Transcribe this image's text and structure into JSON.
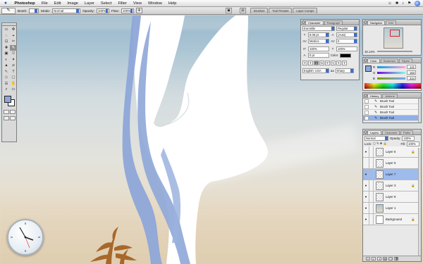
{
  "menubar": {
    "apple": "",
    "items": [
      "Photoshop",
      "File",
      "Edit",
      "Image",
      "Layer",
      "Select",
      "Filter",
      "View",
      "Window",
      "Help"
    ],
    "status_icons": [
      "☺",
      "✱",
      "♪",
      "⚑"
    ]
  },
  "options": {
    "brush_label": "Brush:",
    "brush_size": "",
    "mode_label": "Mode:",
    "mode_value": "Normal",
    "opacity_label": "Opacity:",
    "opacity_value": "100%",
    "flow_label": "Flow:",
    "flow_value": "100%",
    "well_tabs": [
      "Brushes",
      "Tool Presets",
      "Layer Comps"
    ]
  },
  "tools": {
    "foreground_color": "#8ea7d8",
    "background_color": "#ffffff",
    "glyphs": [
      "▭",
      "✥",
      "◌",
      "⌖",
      "⊡",
      "✂",
      "✚",
      "✎",
      "▣",
      "⎋",
      "◐",
      "✦",
      "▲",
      "⌀",
      "↖",
      "T",
      "◇",
      "▢",
      "☰",
      "✋",
      "⌕",
      "▭"
    ]
  },
  "character": {
    "tabs": [
      "Character",
      "Paragraph"
    ],
    "font_family": "Eurostile",
    "font_style": "Regular",
    "font_size": "9.08 pt",
    "leading": "(Auto)",
    "kerning": "Metrics",
    "tracking": "0",
    "vertical_scale": "100%",
    "horizontal_scale": "100%",
    "baseline_shift": "0 pt",
    "color_label": "Color:",
    "style_buttons": [
      "T",
      "T",
      "TT",
      "Tr",
      "T'",
      "T,",
      "T",
      "T"
    ],
    "language": "English: USA",
    "antialias_label": "aa",
    "antialias": "Sharp"
  },
  "navigator": {
    "tabs": [
      "Navigator",
      "Info"
    ],
    "zoom": "16.14%"
  },
  "color": {
    "tabs": [
      "Color",
      "Swatches",
      "Styles"
    ],
    "r_label": "R",
    "g_label": "G",
    "b_label": "B",
    "r": "121",
    "g": "163",
    "b": "224"
  },
  "history": {
    "tabs": [
      "History",
      "Actions"
    ],
    "items": [
      "Brush Tool",
      "Brush Tool",
      "Brush Tool",
      "Brush Tool"
    ]
  },
  "layers": {
    "tabs": [
      "Layers",
      "Channels",
      "Paths"
    ],
    "blend_mode": "Normal",
    "opacity_label": "Opacity:",
    "opacity": "100%",
    "lock_label": "Lock:",
    "fill_label": "Fill:",
    "fill": "100%",
    "rows": [
      {
        "name": "Layer 6",
        "visible": "●",
        "thumb": "transparent",
        "lock": "🔒"
      },
      {
        "name": "Layer 5",
        "visible": "",
        "thumb": "transparent",
        "lock": ""
      },
      {
        "name": "Layer 7",
        "visible": "●",
        "thumb": "transparent",
        "lock": ""
      },
      {
        "name": "Layer 3",
        "visible": "●",
        "thumb": "transparent",
        "lock": "🔒"
      },
      {
        "name": "Layer 8",
        "visible": "●",
        "thumb": "transparent",
        "lock": ""
      },
      {
        "name": "Layer 1",
        "visible": "●",
        "thumb": "photo",
        "lock": ""
      },
      {
        "name": "Background",
        "visible": "●",
        "thumb": "white",
        "lock": "🔒"
      }
    ],
    "footer_icons": [
      "∞",
      "ƒ",
      "◑",
      "▤",
      "▢",
      "🗑"
    ]
  }
}
